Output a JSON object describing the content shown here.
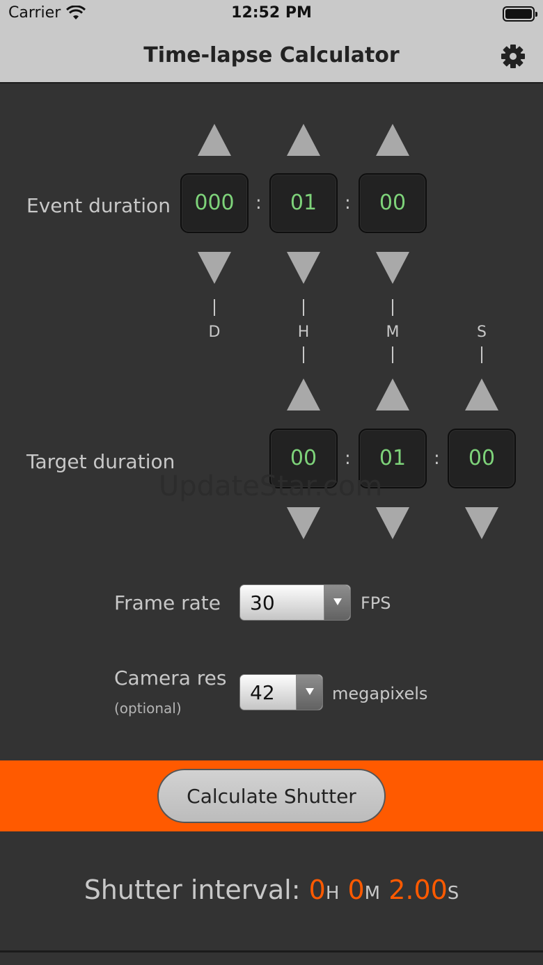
{
  "status_bar": {
    "carrier": "Carrier",
    "time": "12:52 PM"
  },
  "nav": {
    "title": "Time-lapse Calculator",
    "settings_icon": "gear-icon"
  },
  "event": {
    "label": "Event duration",
    "days": "000",
    "hours": "01",
    "minutes": "00"
  },
  "units": {
    "d": "D",
    "h": "H",
    "m": "M",
    "s": "S"
  },
  "target": {
    "label": "Target duration",
    "hours": "00",
    "minutes": "01",
    "seconds": "00"
  },
  "separator": ":",
  "frame_rate": {
    "label": "Frame rate",
    "value": "30",
    "unit": "FPS"
  },
  "camera_res": {
    "label": "Camera res",
    "optional": "(optional)",
    "value": "42",
    "unit": "megapixels"
  },
  "calculate": {
    "label": "Calculate Shutter"
  },
  "result": {
    "label": "Shutter interval: ",
    "hours": "0",
    "hours_unit": "H",
    "minutes": "0",
    "minutes_unit": "M",
    "seconds": "2.00",
    "seconds_unit": "S"
  },
  "watermark": "UpdateStar.com",
  "colors": {
    "accent": "#ff5a00",
    "digits": "#7ed37a",
    "background": "#333333",
    "bar": "#c9c9c9"
  }
}
